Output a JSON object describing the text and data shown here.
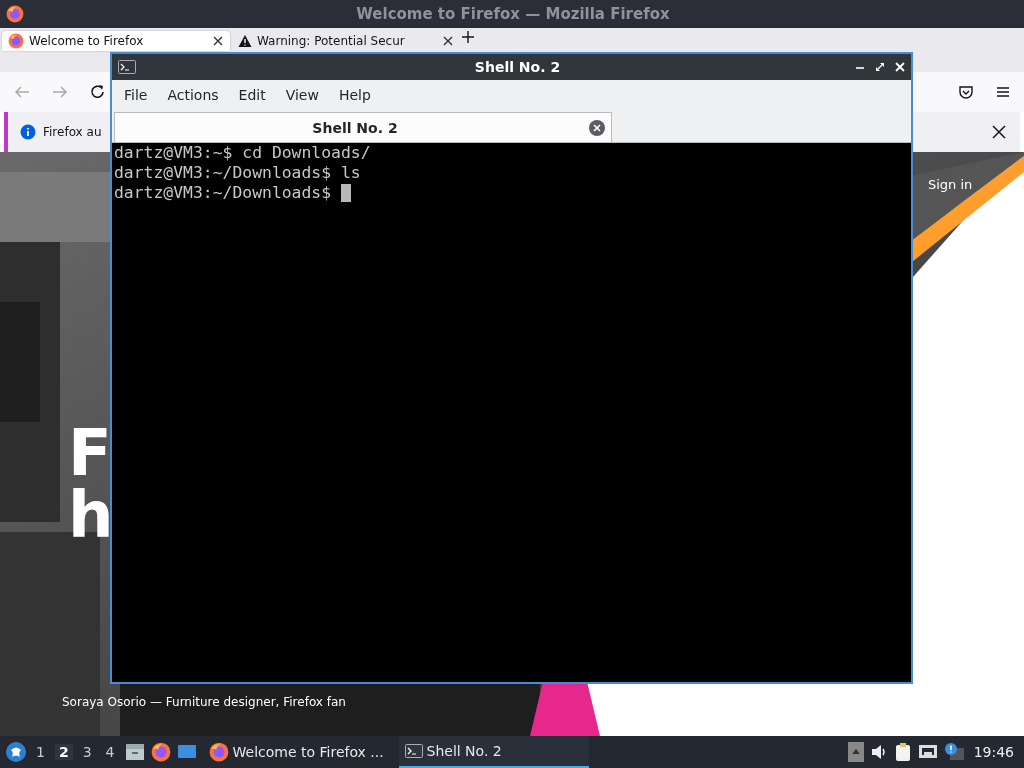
{
  "firefox": {
    "title": "Welcome to Firefox — Mozilla Firefox",
    "tabs": [
      {
        "label": "Welcome to Firefox",
        "selected": true
      },
      {
        "label": "Warning: Potential Secur",
        "selected": false
      }
    ],
    "notification": {
      "text": "Firefox au"
    },
    "page": {
      "heading_lines": [
        "F",
        "h"
      ],
      "sign_in": "Sign in",
      "caption": "Soraya Osorio — Furniture designer, Firefox fan"
    }
  },
  "terminal": {
    "title": "Shell No. 2",
    "menu": [
      "File",
      "Actions",
      "Edit",
      "View",
      "Help"
    ],
    "tabs": [
      {
        "label": "Shell No. 2",
        "selected": true
      }
    ],
    "lines": [
      "dartz@VM3:~$ cd Downloads/",
      "dartz@VM3:~/Downloads$ ls",
      "dartz@VM3:~/Downloads$"
    ]
  },
  "taskbar": {
    "workspaces": [
      {
        "label": "1",
        "selected": false
      },
      {
        "label": "2",
        "selected": true
      },
      {
        "label": "3",
        "selected": false
      },
      {
        "label": "4",
        "selected": false
      }
    ],
    "tasks": [
      {
        "kind": "browser",
        "label": "Welcome to Firefox ...",
        "selected": false
      },
      {
        "kind": "terminal",
        "label": "Shell No. 2",
        "selected": true
      }
    ],
    "clock": "19:46"
  }
}
